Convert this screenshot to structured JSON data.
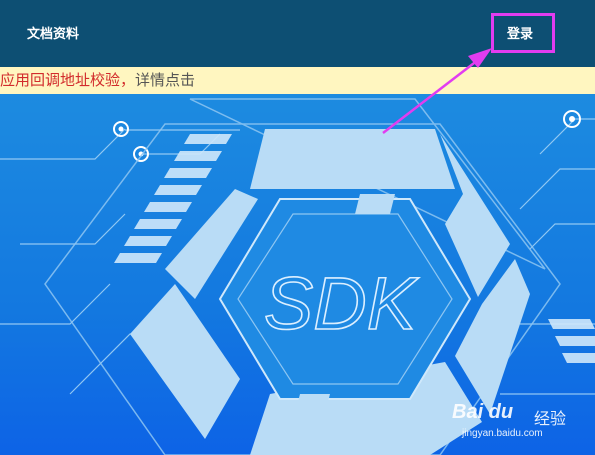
{
  "header": {
    "docs_label": "文档资料",
    "login_label": "登录"
  },
  "notice": {
    "red_text": "应用回调地址校验，",
    "link_text": "详情点击"
  },
  "hero": {
    "logo_text": "SDK"
  },
  "watermark": {
    "logo": "Bai du",
    "subtitle": "经验",
    "url": "jingyan.baidu.com"
  },
  "colors": {
    "topbar": "#0d4f73",
    "notice_bg": "#fff6c0",
    "notice_red": "#d22c2c",
    "highlight": "#e23cf0",
    "hero_blue": "#1a7fd6"
  }
}
